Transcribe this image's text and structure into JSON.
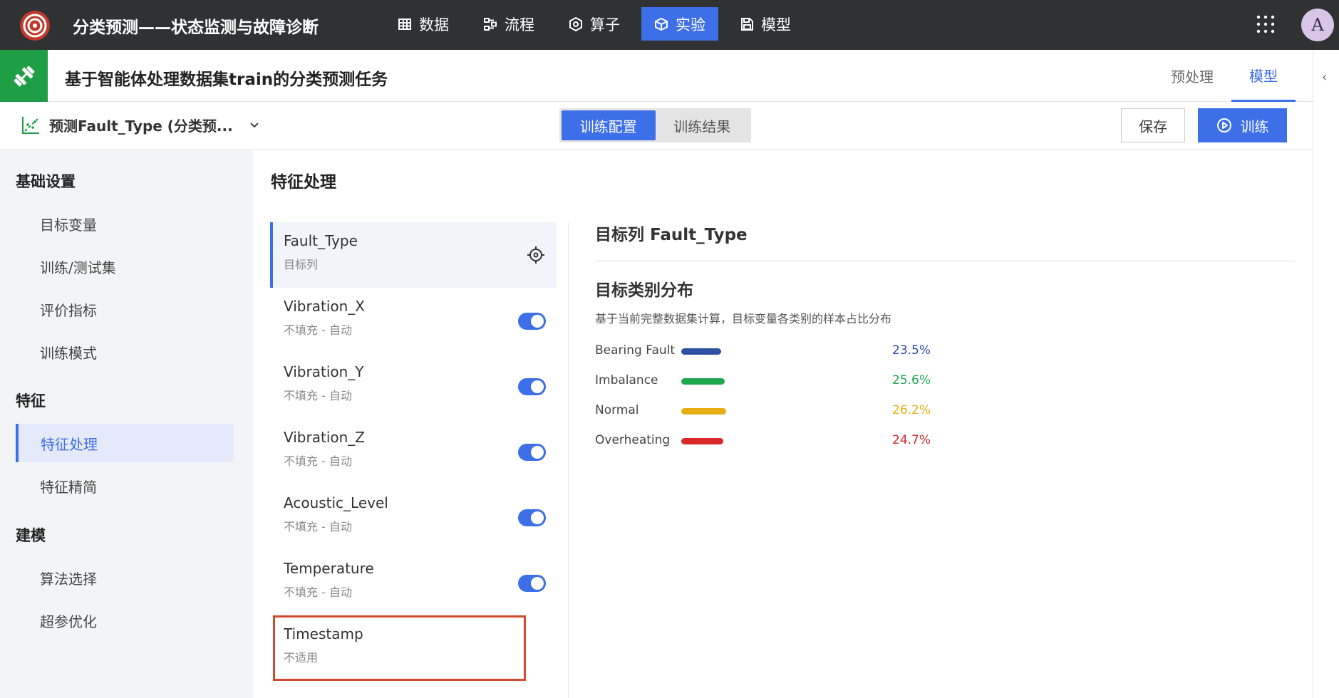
{
  "app": {
    "title": "分类预测——状态监测与故障诊断"
  },
  "nav": [
    {
      "label": "数据",
      "icon": "table-icon",
      "active": false
    },
    {
      "label": "流程",
      "icon": "flow-icon",
      "active": false
    },
    {
      "label": "算子",
      "icon": "operator-icon",
      "active": false
    },
    {
      "label": "实验",
      "icon": "cube-icon",
      "active": true
    },
    {
      "label": "模型",
      "icon": "save-icon",
      "active": false
    }
  ],
  "user": {
    "avatar": "A"
  },
  "task": {
    "title": "基于智能体处理数据集train的分类预测任务",
    "tabs": [
      {
        "label": "预处理",
        "active": false
      },
      {
        "label": "模型",
        "active": true
      }
    ]
  },
  "toolbar": {
    "target_select": "预测Fault_Type (分类预...",
    "segments": [
      {
        "label": "训练配置",
        "active": true
      },
      {
        "label": "训练结果",
        "active": false
      }
    ],
    "save_label": "保存",
    "train_label": "训练"
  },
  "sidebar": {
    "sections": [
      {
        "title": "基础设置",
        "items": [
          "目标变量",
          "训练/测试集",
          "评价指标",
          "训练模式"
        ]
      },
      {
        "title": "特征",
        "items": [
          "特征处理",
          "特征精简"
        ]
      },
      {
        "title": "建模",
        "items": [
          "算法选择",
          "超参优化"
        ]
      }
    ],
    "active_item": "特征处理"
  },
  "main": {
    "title": "特征处理",
    "features": [
      {
        "name": "Fault_Type",
        "sub": "目标列",
        "kind": "target"
      },
      {
        "name": "Vibration_X",
        "sub": "不填充 - 自动",
        "kind": "toggle",
        "enabled": true
      },
      {
        "name": "Vibration_Y",
        "sub": "不填充 - 自动",
        "kind": "toggle",
        "enabled": true
      },
      {
        "name": "Vibration_Z",
        "sub": "不填充 - 自动",
        "kind": "toggle",
        "enabled": true
      },
      {
        "name": "Acoustic_Level",
        "sub": "不填充 - 自动",
        "kind": "toggle",
        "enabled": true
      },
      {
        "name": "Temperature",
        "sub": "不填充 - 自动",
        "kind": "toggle",
        "enabled": true
      },
      {
        "name": "Timestamp",
        "sub": "不适用",
        "kind": "na"
      }
    ]
  },
  "detail": {
    "title": "目标列 Fault_Type",
    "dist_title": "目标类别分布",
    "dist_desc": "基于当前完整数据集计算，目标变量各类别的样本占比分布",
    "classes": [
      {
        "name": "Bearing Fault",
        "value": 0.235,
        "pct": "23.5%",
        "color": "#2f4fa3"
      },
      {
        "name": "Imbalance",
        "value": 0.256,
        "pct": "25.6%",
        "color": "#1fa84f"
      },
      {
        "name": "Normal",
        "value": 0.262,
        "pct": "26.2%",
        "color": "#e6b012"
      },
      {
        "name": "Overheating",
        "value": 0.247,
        "pct": "24.7%",
        "color": "#d9282c"
      }
    ]
  }
}
